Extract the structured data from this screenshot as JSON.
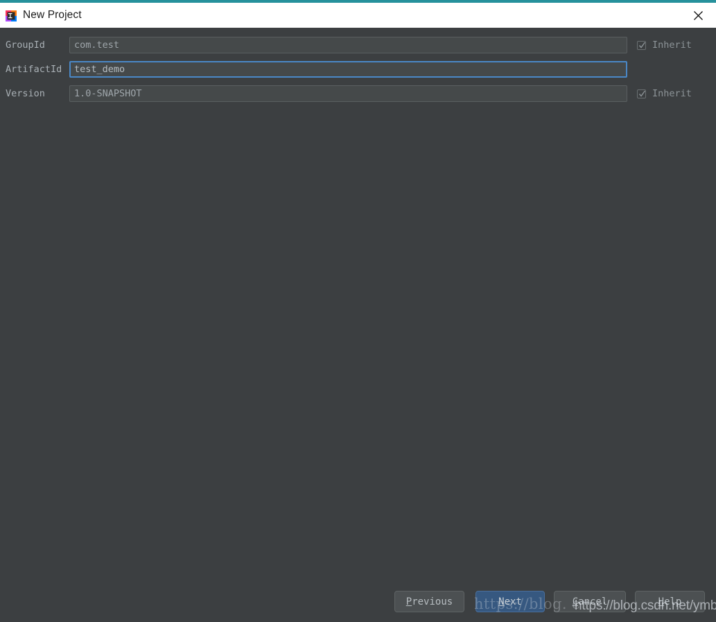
{
  "window": {
    "title": "New Project",
    "app_icon": "intellij-idea-icon",
    "close_icon": "close-icon",
    "accent_color": "#26919c",
    "background_color": "#3c3f41",
    "titlebar_color": "#ffffff"
  },
  "form": {
    "rows": [
      {
        "label": "GroupId",
        "field_name": "groupid-input",
        "value": "com.test",
        "placeholder": "",
        "focused": false,
        "inherit": {
          "label": "Inherit",
          "checked": true,
          "enabled": false
        }
      },
      {
        "label": "ArtifactId",
        "field_name": "artifactid-input",
        "value": "test_demo",
        "placeholder": "",
        "focused": true,
        "inherit": null
      },
      {
        "label": "Version",
        "field_name": "version-input",
        "value": "1.0-SNAPSHOT",
        "placeholder": "",
        "focused": true,
        "inherit": {
          "label": "Inherit",
          "checked": true,
          "enabled": false
        }
      }
    ]
  },
  "footer": {
    "buttons": [
      {
        "name": "previous-button",
        "mnemonic": "P",
        "rest": "revious",
        "default": false
      },
      {
        "name": "next-button",
        "mnemonic": "N",
        "rest": "ext",
        "default": true
      },
      {
        "name": "cancel-button",
        "mnemonic": "C",
        "rest": "ancel",
        "default": false
      },
      {
        "name": "help-button",
        "mnemonic": "H",
        "rest": "elp",
        "default": false
      }
    ]
  },
  "watermarks": {
    "serif_text": "https://blog. c",
    "sans_text": "https://blog.csdn.net/ymblog"
  },
  "colors": {
    "field_background": "#45494a",
    "field_border": "#5a5f61",
    "focus_border": "#4a88c7",
    "default_button": "#365880",
    "text_primary": "#a9b0b5"
  }
}
